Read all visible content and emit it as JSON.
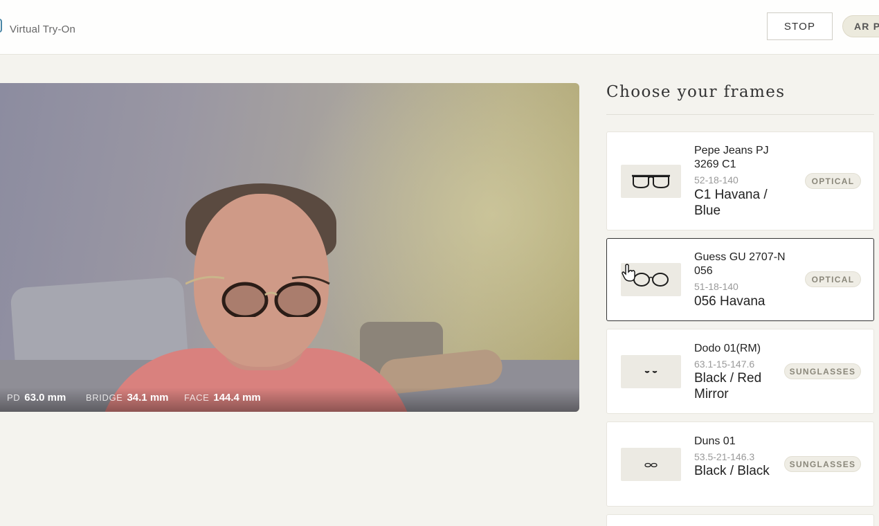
{
  "header": {
    "app_title": "Virtual Try-On",
    "stop_label": "STOP",
    "ar_label": "AR P"
  },
  "video": {
    "measurements": [
      {
        "label": "PD",
        "value": "63.0 mm"
      },
      {
        "label": "BRIDGE",
        "value": "34.1 mm"
      },
      {
        "label": "FACE",
        "value": "144.4 mm"
      }
    ]
  },
  "panel": {
    "title": "Choose your frames",
    "frames": [
      {
        "name": "Pepe Jeans PJ 3269 C1",
        "size": "52-18-140",
        "color": "C1 Havana / Blue",
        "type": "OPTICAL",
        "selected": false
      },
      {
        "name": "Guess GU 2707-N 056",
        "size": "51-18-140",
        "color": "056 Havana",
        "type": "OPTICAL",
        "selected": true
      },
      {
        "name": "Dodo 01(RM)",
        "size": "63.1-15-147.6",
        "color": "Black / Red Mirror",
        "type": "SUNGLASSES",
        "selected": false
      },
      {
        "name": "Duns 01",
        "size": "53.5-21-146.3",
        "color": "Black / Black",
        "type": "SUNGLASSES",
        "selected": false
      }
    ]
  },
  "colors": {
    "accent": "#4a86a6",
    "background": "#f4f3ee",
    "badge_text": "#8a877a"
  },
  "icons": [
    "logo-mark",
    "glasses-thumbnail",
    "hand-cursor"
  ]
}
